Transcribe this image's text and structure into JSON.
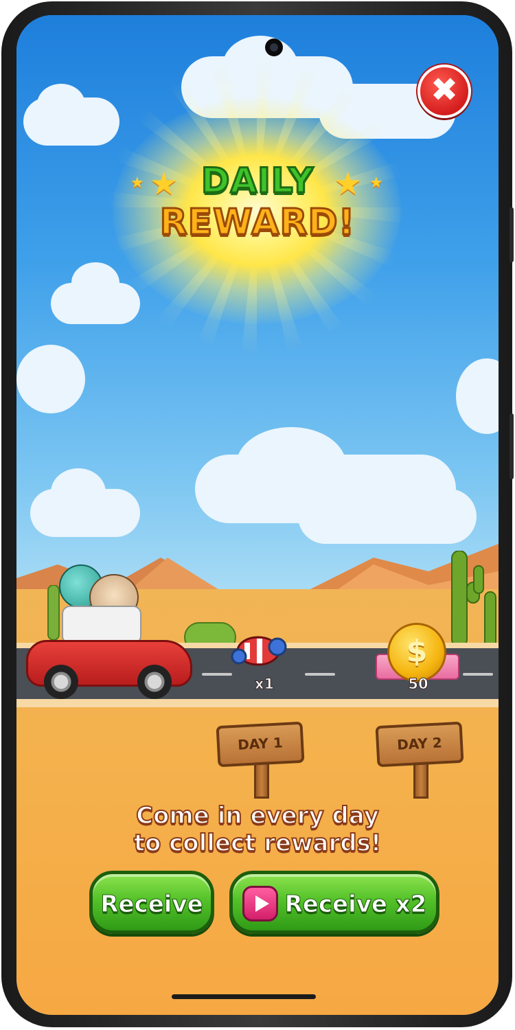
{
  "header": {
    "title_line1": "DAILY",
    "title_line2": "REWARD!"
  },
  "close_button": {
    "label": "✖"
  },
  "rewards": [
    {
      "day_label": "DAY 1",
      "item_name": "rocket-booster",
      "quantity": "x1"
    },
    {
      "day_label": "DAY 2",
      "item_name": "gold-coin",
      "quantity": "50"
    }
  ],
  "message": {
    "line1": "Come in every day",
    "line2": "to collect rewards!"
  },
  "buttons": {
    "receive_label": "Receive",
    "receive_x2_label": "Receive x2"
  },
  "colors": {
    "title_green": "#3fc22a",
    "title_orange": "#ffb21a",
    "button_green": "#55c22a",
    "close_red": "#d41e1e",
    "sky_blue": "#3fa0ea",
    "sand": "#f4b14c"
  }
}
